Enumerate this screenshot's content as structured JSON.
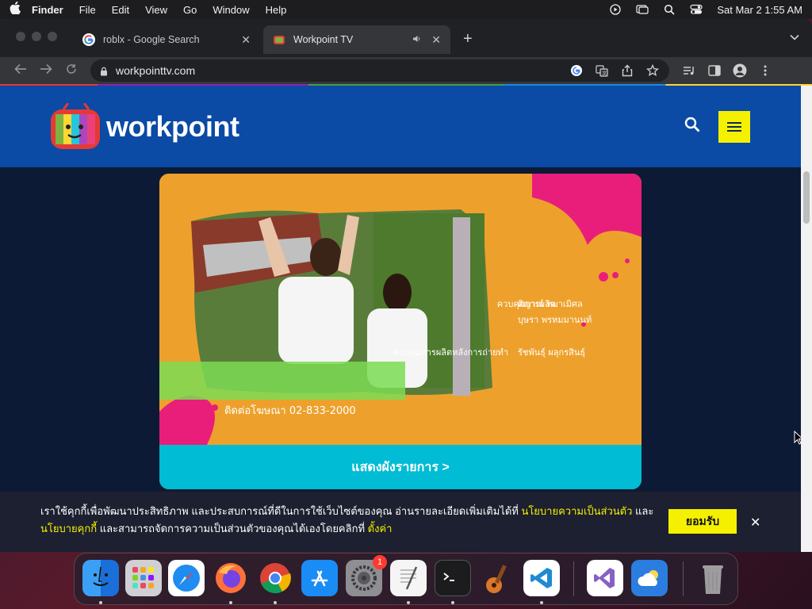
{
  "menubar": {
    "apple": "",
    "items": [
      "Finder",
      "File",
      "Edit",
      "View",
      "Go",
      "Window",
      "Help"
    ],
    "clock": "Sat Mar 2  1:55 AM"
  },
  "browser": {
    "tabs": [
      {
        "title": "roblx - Google Search",
        "favicon": "google-icon",
        "active": false
      },
      {
        "title": "Workpoint TV",
        "favicon": "workpoint-icon",
        "active": true,
        "audio": true
      }
    ],
    "url": "workpointtv.com"
  },
  "site": {
    "logo_text": "workpoint",
    "colors": {
      "header": "#0b4aa5",
      "accent": "#f5f000",
      "cta": "#00bcd4",
      "card": "#eda12c"
    }
  },
  "card": {
    "credits": [
      {
        "role": "ควบคุมการผลิต",
        "name": "ศิญาณ์ ทมาเมิศล"
      },
      {
        "role": "",
        "name": "บุษรา พรหมมานนท์"
      },
      {
        "role": "ควบคุมการผลิตหลังการถ่ายทำ",
        "name": "รัชพันธุ์ ผลุกรสินธุ์"
      }
    ],
    "contact": "ติดต่อโฆษณา  02-833-2000",
    "cta_label": "แสดงผังรายการ >"
  },
  "cookie": {
    "line1_pre": "เราใช้คุกกี้เพื่อพัฒนาประสิทธิภาพ และประสบการณ์ที่ดีในการใช้เว็บไซต์ของคุณ อ่านรายละเอียดเพิ่มเติมได้ที่ ",
    "privacy_link": "นโยบายความเป็นส่วนตัว",
    "line1_post": " และ",
    "cookie_link": "นโยบายคุกกี้",
    "line2_mid": " และสามารถจัดการความเป็นส่วนตัวของคุณได้เองโดยคลิกที่ ",
    "settings_link": "ตั้งค่า",
    "accept_label": "ยอมรับ"
  },
  "dock": {
    "apps": [
      "finder",
      "launchpad",
      "safari",
      "firefox",
      "chrome",
      "app-store",
      "system-preferences",
      "textedit",
      "terminal",
      "garageband",
      "vscode",
      "visual-studio",
      "weather",
      "trash"
    ],
    "system_preferences_badge": "1"
  }
}
